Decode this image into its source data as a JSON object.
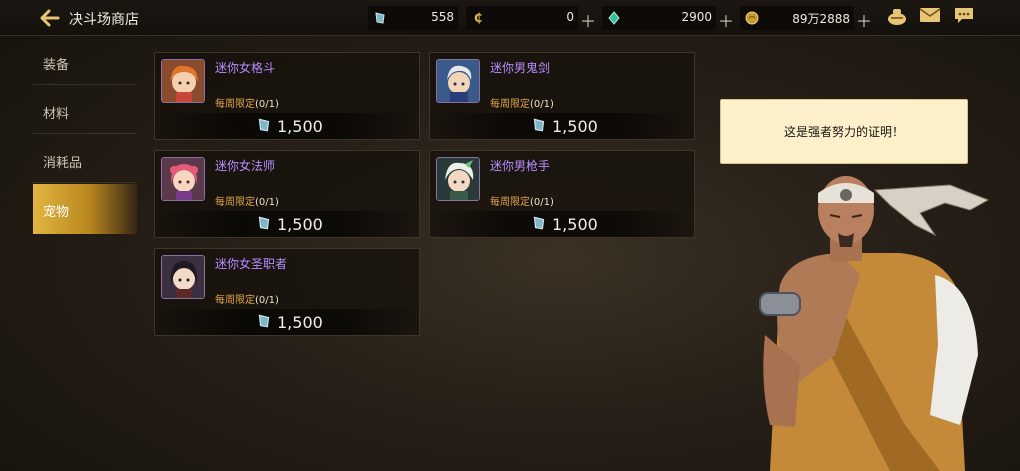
{
  "header": {
    "title": "决斗场商店",
    "currencies": [
      {
        "icon": "gem-icon",
        "value": "558",
        "has_plus": false
      },
      {
        "icon": "c-coin-icon",
        "value": "0",
        "has_plus": true
      },
      {
        "icon": "crystal-icon",
        "value": "2900",
        "has_plus": true
      },
      {
        "icon": "gold-icon",
        "value": "89万2888",
        "has_plus": true
      }
    ]
  },
  "sidebar": {
    "items": [
      {
        "label": "装备",
        "active": false
      },
      {
        "label": "材料",
        "active": false
      },
      {
        "label": "消耗品",
        "active": false
      },
      {
        "label": "宠物",
        "active": true
      }
    ]
  },
  "items": [
    {
      "name": "迷你女格斗",
      "limit_label": "每周限定",
      "limit": "(0/1)",
      "price": "1,500"
    },
    {
      "name": "迷你男鬼剑",
      "limit_label": "每周限定",
      "limit": "(0/1)",
      "price": "1,500"
    },
    {
      "name": "迷你女法师",
      "limit_label": "每周限定",
      "limit": "(0/1)",
      "price": "1,500"
    },
    {
      "name": "迷你男枪手",
      "limit_label": "每周限定",
      "limit": "(0/1)",
      "price": "1,500"
    },
    {
      "name": "迷你女圣职者",
      "limit_label": "每周限定",
      "limit": "(0/1)",
      "price": "1,500"
    }
  ],
  "npc": {
    "speech": "这是强者努力的证明！"
  },
  "colors": {
    "accent": "#e2b53f",
    "item_name": "#b88bff",
    "limit": "#e0a64a"
  }
}
